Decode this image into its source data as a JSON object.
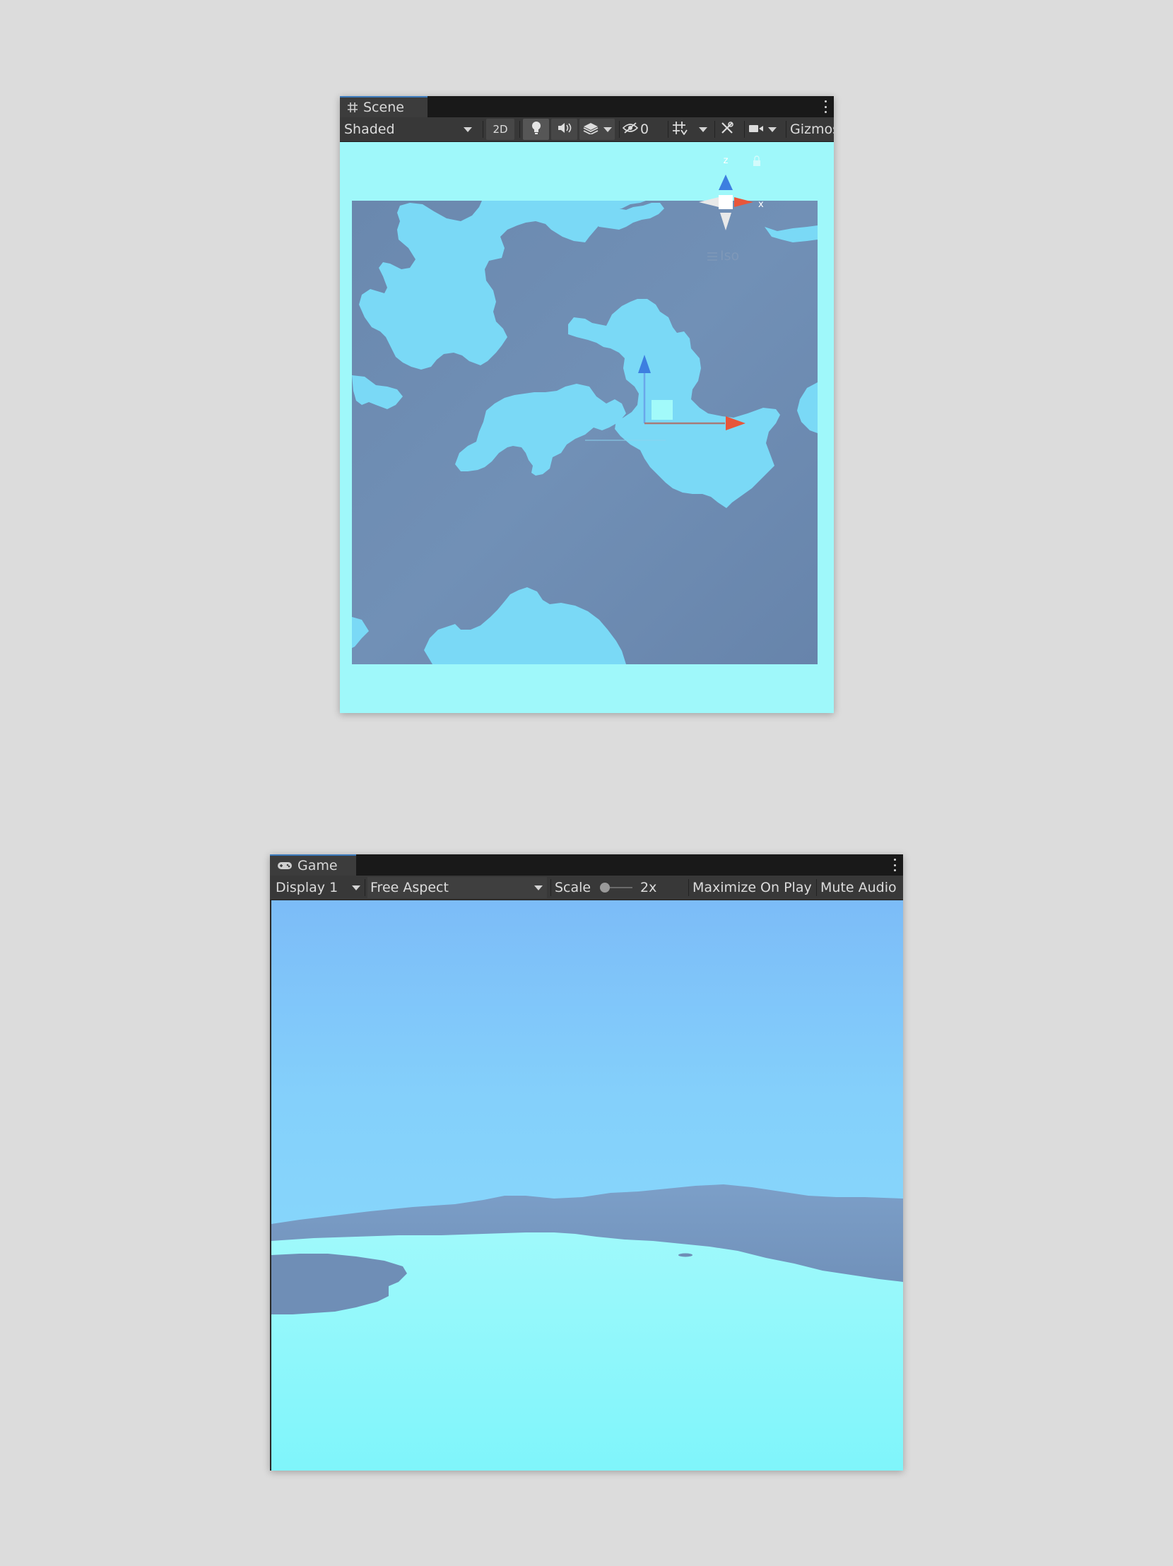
{
  "scene": {
    "tab_label": "Scene",
    "tab_icon": "grid-hash-icon",
    "draw_mode": "Shaded",
    "toggle_2d": "2D",
    "hidden_count": "0",
    "gizmos_label": "Gizmos",
    "orientation_label": "Iso",
    "axis_z": "z",
    "axis_x": "x"
  },
  "game": {
    "tab_label": "Game",
    "tab_icon": "gamepad-icon",
    "display": "Display 1",
    "aspect": "Free Aspect",
    "scale_label": "Scale",
    "scale_value": "2x",
    "maximize_on_play": "Maximize On Play",
    "mute_audio": "Mute Audio"
  },
  "colors": {
    "water": "#9ff8fa",
    "land_blue": "#6f8db3",
    "light_blue": "#7ad9f6",
    "gizmo_x": "#e8563a",
    "gizmo_z": "#3d7fe0"
  }
}
